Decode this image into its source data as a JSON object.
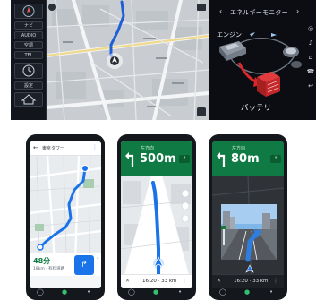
{
  "headunit": {
    "left_tiles": [
      "ナビ",
      "AUDIO",
      "空調",
      "TEL",
      "設定",
      "燃費"
    ],
    "energy_monitor": {
      "title": "エネルギーモニター",
      "engine_label": "エンジン",
      "battery_label": "バッテリー",
      "nav_prev": "‹",
      "nav_next": "›"
    },
    "side_icons": [
      "◎",
      "♪",
      "⌂",
      "☎",
      "↩"
    ]
  },
  "phones": [
    {
      "screen": "route_overview",
      "destination": "東京タワー",
      "time": "48分",
      "subtext": "18km · 有料道路",
      "go_label": "↱",
      "side_text": "↑"
    },
    {
      "screen": "turn_guidance",
      "direction_hint": "左方向",
      "distance": "500m",
      "eta": "16:20 · 33 km",
      "mini_label": "↑"
    },
    {
      "screen": "junction_view",
      "direction_hint": "左方向",
      "distance": "80m",
      "eta": "16:20 · 33 km",
      "mini_label": "↑"
    }
  ],
  "colors": {
    "guidance_green": "#0f7a43",
    "route_blue": "#1a73e8",
    "battery_red": "#d8282a",
    "headunit_bg": "#0d0f14"
  }
}
